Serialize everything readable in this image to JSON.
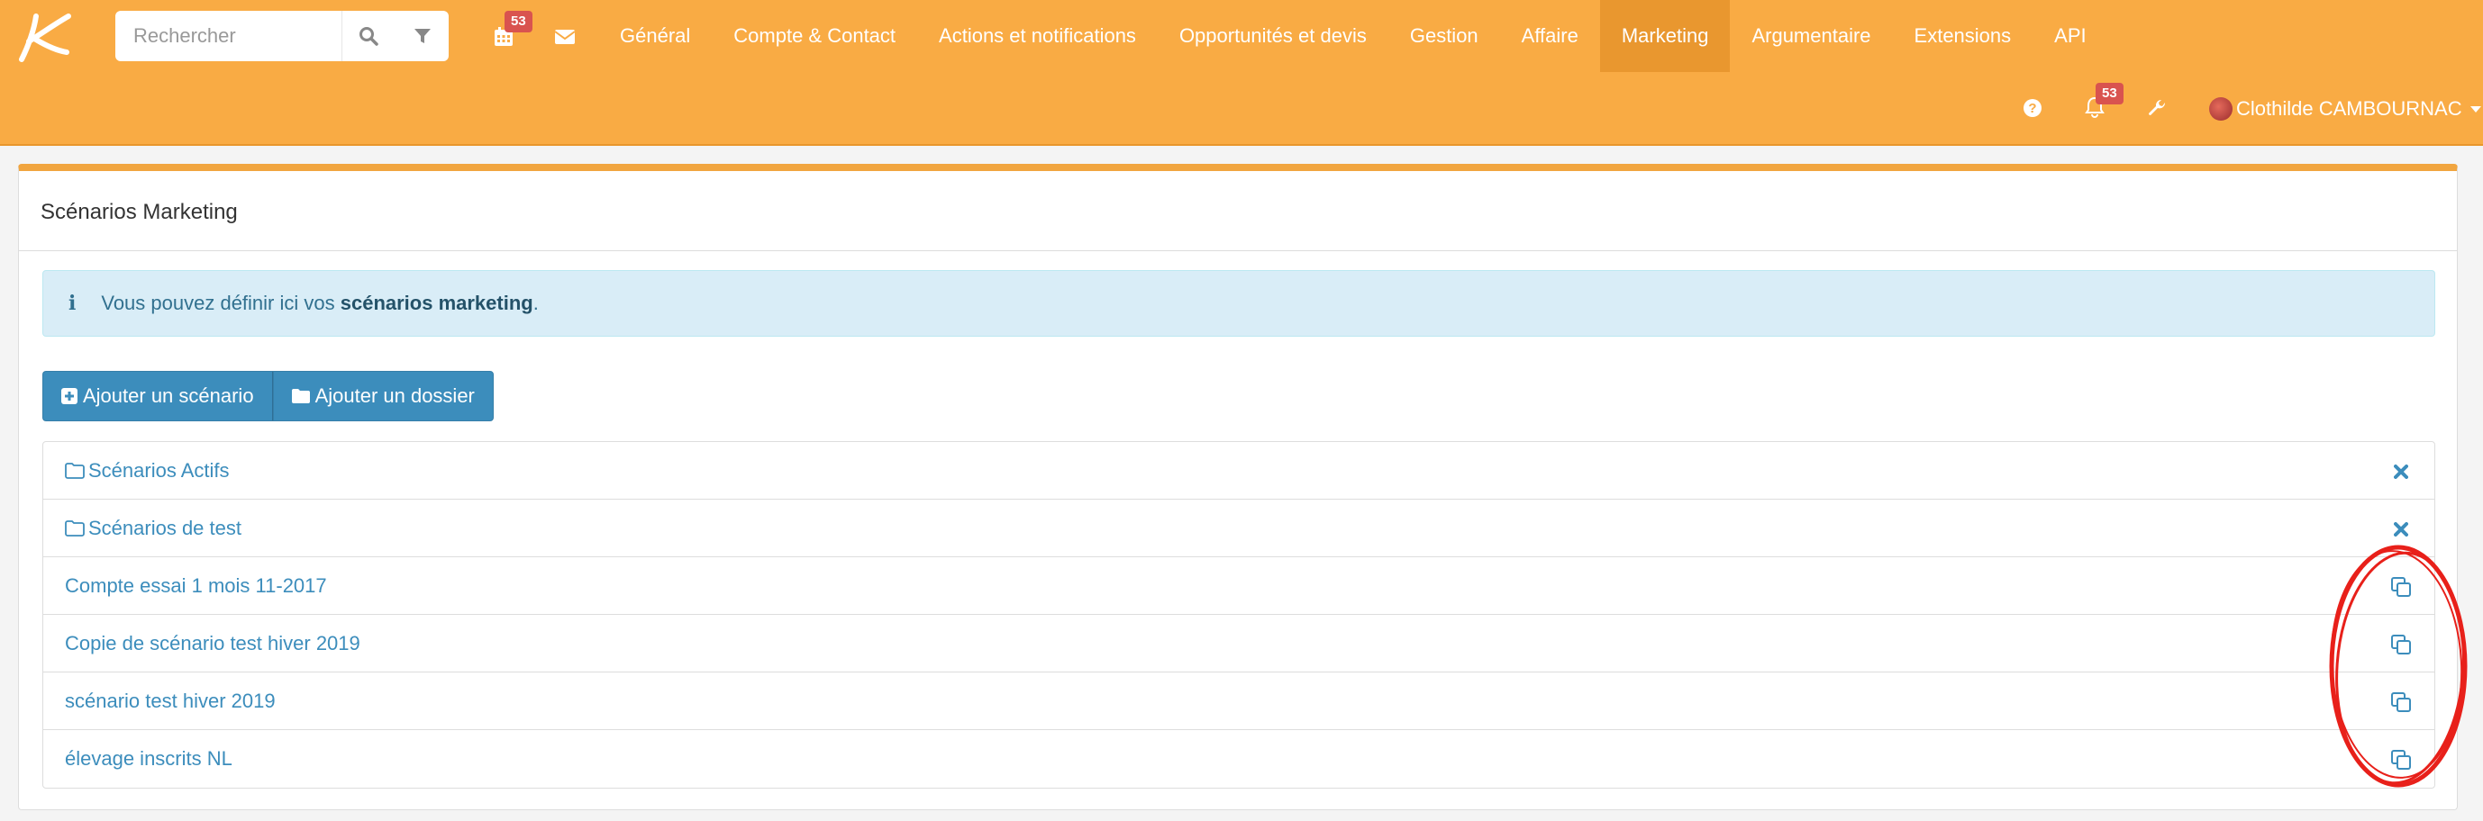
{
  "header": {
    "search": {
      "placeholder": "Rechercher"
    },
    "calendar_badge": "53",
    "notifications_badge": "53",
    "nav": [
      {
        "label": "Général"
      },
      {
        "label": "Compte & Contact"
      },
      {
        "label": "Actions et notifications"
      },
      {
        "label": "Opportunités et devis"
      },
      {
        "label": "Gestion"
      },
      {
        "label": "Affaire"
      },
      {
        "label": "Marketing",
        "active": true
      },
      {
        "label": "Argumentaire"
      },
      {
        "label": "Extensions"
      },
      {
        "label": "API"
      }
    ],
    "user_name": "Clothilde CAMBOURNAC"
  },
  "panel": {
    "title": "Scénarios Marketing",
    "info": {
      "prefix": "Vous pouvez définir ici vos ",
      "bold": "scénarios marketing",
      "suffix": "."
    },
    "buttons": {
      "add_scenario": "Ajouter un scénario",
      "add_folder": "Ajouter un dossier"
    },
    "rows": [
      {
        "label": "Scénarios Actifs",
        "type": "folder",
        "action": "delete"
      },
      {
        "label": "Scénarios de test",
        "type": "folder",
        "action": "delete"
      },
      {
        "label": "Compte essai 1 mois 11-2017",
        "type": "scenario",
        "action": "copy"
      },
      {
        "label": "Copie de scénario test hiver 2019",
        "type": "scenario",
        "action": "copy"
      },
      {
        "label": "scénario test hiver 2019",
        "type": "scenario",
        "action": "copy"
      },
      {
        "label": "élevage inscrits NL",
        "type": "scenario",
        "action": "copy"
      }
    ]
  },
  "colors": {
    "header_bg": "#f9ab44",
    "nav_active_bg": "#e9972f",
    "primary": "#3c8dbc",
    "info_bg": "#d9edf7",
    "badge": "#d9534f",
    "annotation": "#e8201a"
  },
  "icons": {
    "logo": "k-logo-icon",
    "search": "search-icon",
    "filter": "filter-icon",
    "calendar": "calendar-icon",
    "mail": "envelope-icon",
    "help": "question-circle-icon",
    "bell": "bell-icon",
    "settings": "wrench-icon",
    "user_caret": "caret-down-icon",
    "info": "info-icon",
    "add": "plus-square-icon",
    "folder": "folder-icon",
    "delete": "times-icon",
    "copy": "copy-icon"
  }
}
